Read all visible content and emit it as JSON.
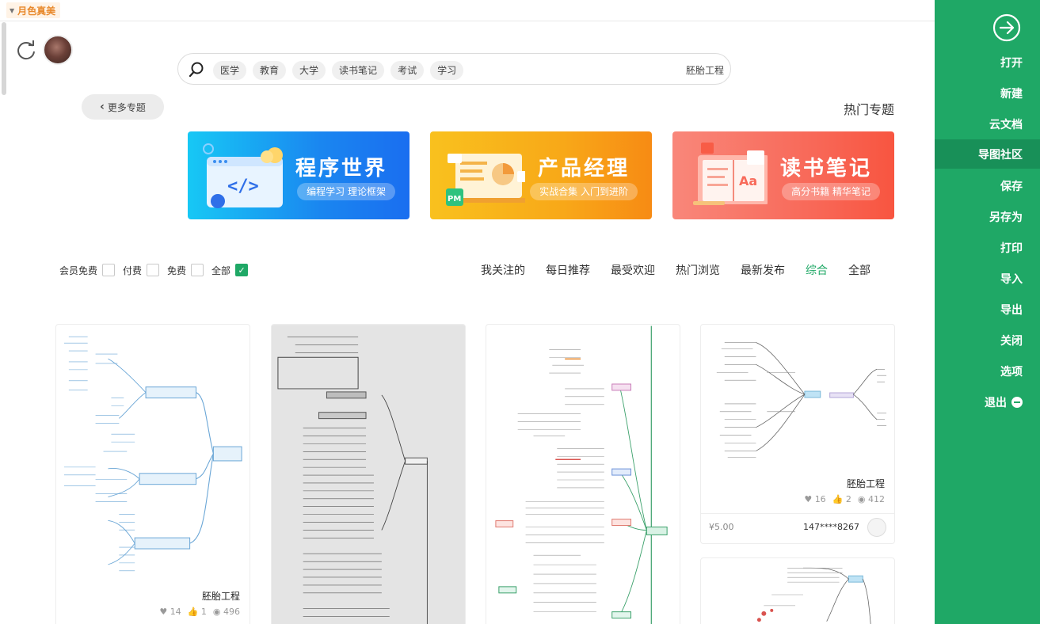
{
  "topbar": {
    "dropdown_label": "月色真美"
  },
  "search": {
    "query": "胚胎工程",
    "tags": [
      "医学",
      "教育",
      "大学",
      "读书笔记",
      "考试",
      "学习"
    ]
  },
  "section": {
    "title": "热门专题",
    "more_label": "更多专题"
  },
  "banners": [
    {
      "title": "程序世界",
      "subtitle": "编程学习 理论框架"
    },
    {
      "title": "产品经理",
      "subtitle": "实战合集 入门到进阶"
    },
    {
      "title": "读书笔记",
      "subtitle": "高分书籍 精华笔记"
    }
  ],
  "filters": [
    {
      "label": "全部",
      "checked": true
    },
    {
      "label": "免费",
      "checked": false
    },
    {
      "label": "付费",
      "checked": false
    },
    {
      "label": "会员免费",
      "checked": false
    }
  ],
  "tabs": [
    {
      "label": "我关注的",
      "active": false
    },
    {
      "label": "每日推荐",
      "active": false
    },
    {
      "label": "最受欢迎",
      "active": false
    },
    {
      "label": "热门浏览",
      "active": false
    },
    {
      "label": "最新发布",
      "active": false
    },
    {
      "label": "综合",
      "active": true
    },
    {
      "label": "全部",
      "active": false
    }
  ],
  "cards": [
    {
      "title": "胚胎工程",
      "views": "412",
      "likes": "2",
      "favorites": "16",
      "user": "147****8267",
      "price": "¥5.00"
    },
    {
      "title": "胚胎工程",
      "views": "496",
      "likes": "1",
      "favorites": "14"
    }
  ],
  "sidebar": {
    "items": [
      {
        "label": "打开",
        "active": false
      },
      {
        "label": "新建",
        "active": false
      },
      {
        "label": "云文档",
        "active": false
      },
      {
        "label": "导图社区",
        "active": true
      },
      {
        "label": "保存",
        "active": false
      },
      {
        "label": "另存为",
        "active": false
      },
      {
        "label": "打印",
        "active": false
      },
      {
        "label": "导入",
        "active": false
      },
      {
        "label": "导出",
        "active": false
      },
      {
        "label": "关闭",
        "active": false
      },
      {
        "label": "选项",
        "active": false
      },
      {
        "label": "退出",
        "active": false
      }
    ]
  },
  "colors": {
    "brand": "#1fa866",
    "sidebar_active": "#189058"
  }
}
